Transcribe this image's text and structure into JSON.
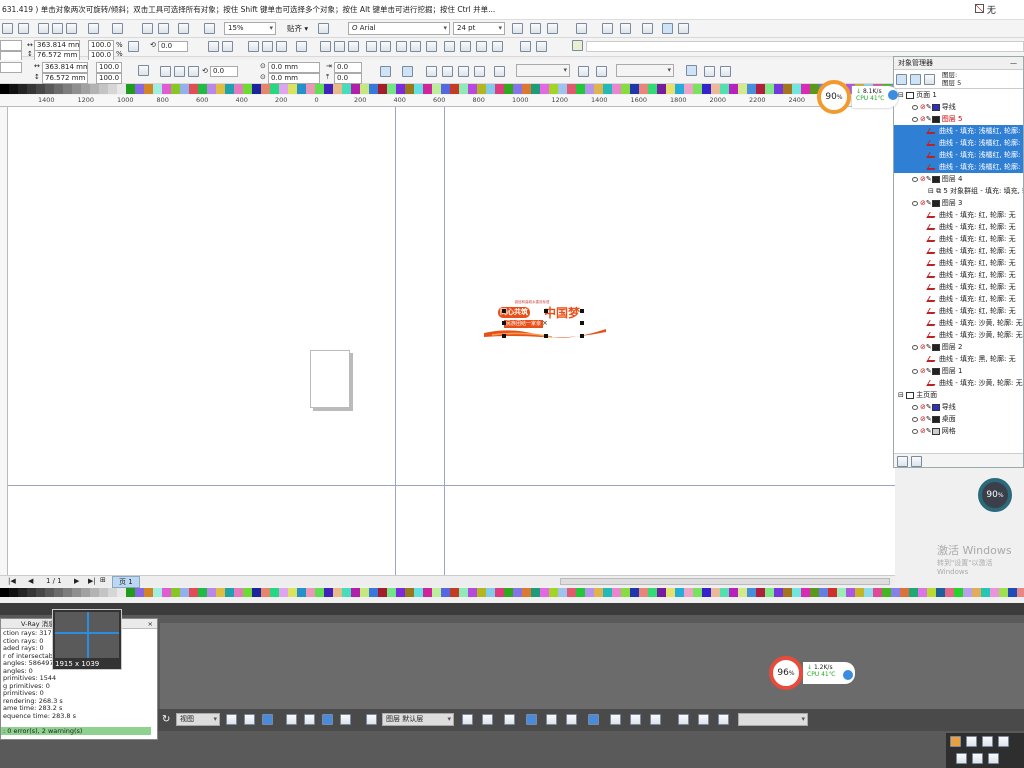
{
  "status_hint": "631.419 ) 单击对象两次可旋转/倾斜；双击工具可选择所有对象；按住 Shift 键单击可选择多个对象；按住 Alt 键单击可进行挖掘；按住 Ctrl 并单...",
  "top_right": {
    "fill_label": "无"
  },
  "toolbar1": {
    "zoom": "15%",
    "snap_label": "贴齐",
    "font_name": "Arial",
    "font_size": "24 pt"
  },
  "prop_bar": {
    "width1": "363.814 mm",
    "height1": "76.572 mm",
    "scale_x1": "100.0",
    "scale_y1": "100.0",
    "pct1": "%",
    "pct2": "%",
    "angle1": "0.0",
    "width2": "363.814 mm",
    "height2": "76.572 mm",
    "scale_x2": "100.0",
    "scale_y2": "100.0",
    "angle2": "0.0",
    "pos_x": "0.0 mm",
    "pos_y": "0.0 mm",
    "skew_x": "0.0",
    "skew_y": "0.0"
  },
  "ruler": {
    "labels": [
      "1400",
      "1200",
      "1000",
      "800",
      "600",
      "400",
      "200",
      "0",
      "200",
      "400",
      "600",
      "800",
      "1000",
      "1200",
      "1400",
      "1600",
      "1800",
      "2000",
      "2200",
      "2400",
      "2600"
    ]
  },
  "page_nav": {
    "counter": "1 / 1",
    "page_tab": "页 1"
  },
  "object_manager": {
    "title": "对象管理器",
    "header_lines": [
      "图层:",
      "图层 5"
    ],
    "rows": [
      {
        "label": "页面 1",
        "kind": "page"
      },
      {
        "label": "导线",
        "kind": "layer",
        "color": "#3030c0"
      },
      {
        "label": "图层 5",
        "kind": "layer",
        "color": "#222",
        "red": true
      },
      {
        "label": "曲线 - 填充: 浅橘红, 轮廓:",
        "kind": "item",
        "selected": true
      },
      {
        "label": "曲线 - 填充: 浅橘红, 轮廓:",
        "kind": "item",
        "selected": true
      },
      {
        "label": "曲线 - 填充: 浅橘红, 轮廓:",
        "kind": "item",
        "selected": true
      },
      {
        "label": "曲线 - 填充: 浅橘红, 轮廓:",
        "kind": "item",
        "selected": true
      },
      {
        "label": "图层 4",
        "kind": "layer",
        "color": "#222"
      },
      {
        "label": "5 对象群组 - 填充: 填充, 轮",
        "kind": "group"
      },
      {
        "label": "图层 3",
        "kind": "layer",
        "color": "#222"
      },
      {
        "label": "曲线 - 填充: 红, 轮廓: 无",
        "kind": "item"
      },
      {
        "label": "曲线 - 填充: 红, 轮廓: 无",
        "kind": "item"
      },
      {
        "label": "曲线 - 填充: 红, 轮廓: 无",
        "kind": "item"
      },
      {
        "label": "曲线 - 填充: 红, 轮廓: 无",
        "kind": "item"
      },
      {
        "label": "曲线 - 填充: 红, 轮廓: 无",
        "kind": "item"
      },
      {
        "label": "曲线 - 填充: 红, 轮廓: 无",
        "kind": "item"
      },
      {
        "label": "曲线 - 填充: 红, 轮廓: 无",
        "kind": "item"
      },
      {
        "label": "曲线 - 填充: 红, 轮廓: 无",
        "kind": "item"
      },
      {
        "label": "曲线 - 填充: 红, 轮廓: 无",
        "kind": "item"
      },
      {
        "label": "曲线 - 填充: 沙黄, 轮廓: 无",
        "kind": "item"
      },
      {
        "label": "曲线 - 填充: 沙黄, 轮廓: 无",
        "kind": "item"
      },
      {
        "label": "图层 2",
        "kind": "layer",
        "color": "#222"
      },
      {
        "label": "曲线 - 填充: 黑, 轮廓: 无",
        "kind": "item"
      },
      {
        "label": "图层 1",
        "kind": "layer",
        "color": "#222"
      },
      {
        "label": "曲线 - 填充: 沙黄, 轮廓: 无",
        "kind": "item"
      },
      {
        "label": "主页面",
        "kind": "page"
      },
      {
        "label": "导线",
        "kind": "layer",
        "color": "#3030c0"
      },
      {
        "label": "桌面",
        "kind": "layer",
        "color": "#222"
      },
      {
        "label": "网格",
        "kind": "layer",
        "color": "#ccc"
      }
    ]
  },
  "gauges": {
    "top": {
      "pct": "90",
      "unit": "%",
      "net": "8.1K/s",
      "cpu": "CPU 41℃"
    },
    "right": {
      "pct": "90",
      "unit": "%"
    },
    "bottom": {
      "pct": "96",
      "unit": "%",
      "net": "1.2K/s",
      "cpu": "CPU 41℃"
    }
  },
  "activation": {
    "line1": "激活 Windows",
    "line2": "转到\"设置\"以激活 Windows"
  },
  "artwork": {
    "small_text": "诚信和谐城乡建设标语",
    "main_left": "同心共筑",
    "main_right": "中国梦",
    "sub": "民族团结一家亲"
  },
  "vray": {
    "title": "V-Ray 消息",
    "thumb_size": "1915 x 1039",
    "lines": [
      "ction rays: 3177202",
      "ction rays: 0",
      "aded rays: 0",
      "r of intersectable p",
      "angles: 586497",
      "angles: 0",
      "primitives: 1544",
      "g primitives: 0",
      "primitives: 0",
      "rendering: 268.3 s",
      "ame time: 283.2 s",
      "equence time: 283.8 s"
    ],
    "status": ": 0 error(s), 2 warning(s)"
  },
  "bottom_toolbar": {
    "view_label": "视图",
    "layer_select": "图层 默认层"
  }
}
